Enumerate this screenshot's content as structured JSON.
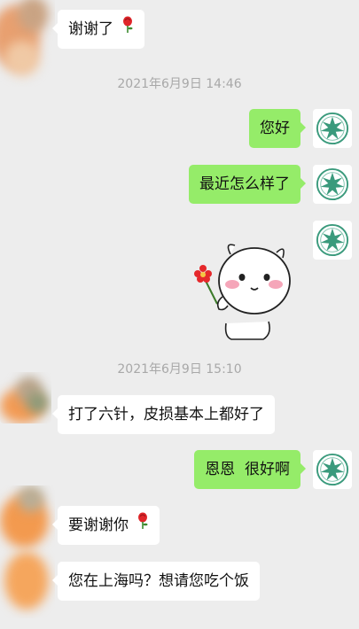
{
  "colors": {
    "background": "#ededed",
    "incoming_bubble": "#ffffff",
    "outgoing_bubble": "#95ec69",
    "timestamp_text": "#a8a8a8"
  },
  "messages": {
    "m1": {
      "text": "谢谢了",
      "emoji": "rose-icon"
    },
    "ts1": "2021年6月9日 14:46",
    "m2": {
      "text": "您好"
    },
    "m3": {
      "text": "最近怎么样了"
    },
    "sticker": {
      "name": "cartoon-holding-flower-sticker"
    },
    "ts2": "2021年6月9日 15:10",
    "m4": {
      "text": "打了六针，皮损基本上都好了"
    },
    "m5": {
      "text": "恩恩  很好啊"
    },
    "m6": {
      "text": "要谢谢你",
      "emoji": "rose-icon"
    },
    "m7": {
      "text": "您在上海吗？想请您吃个饭"
    }
  }
}
